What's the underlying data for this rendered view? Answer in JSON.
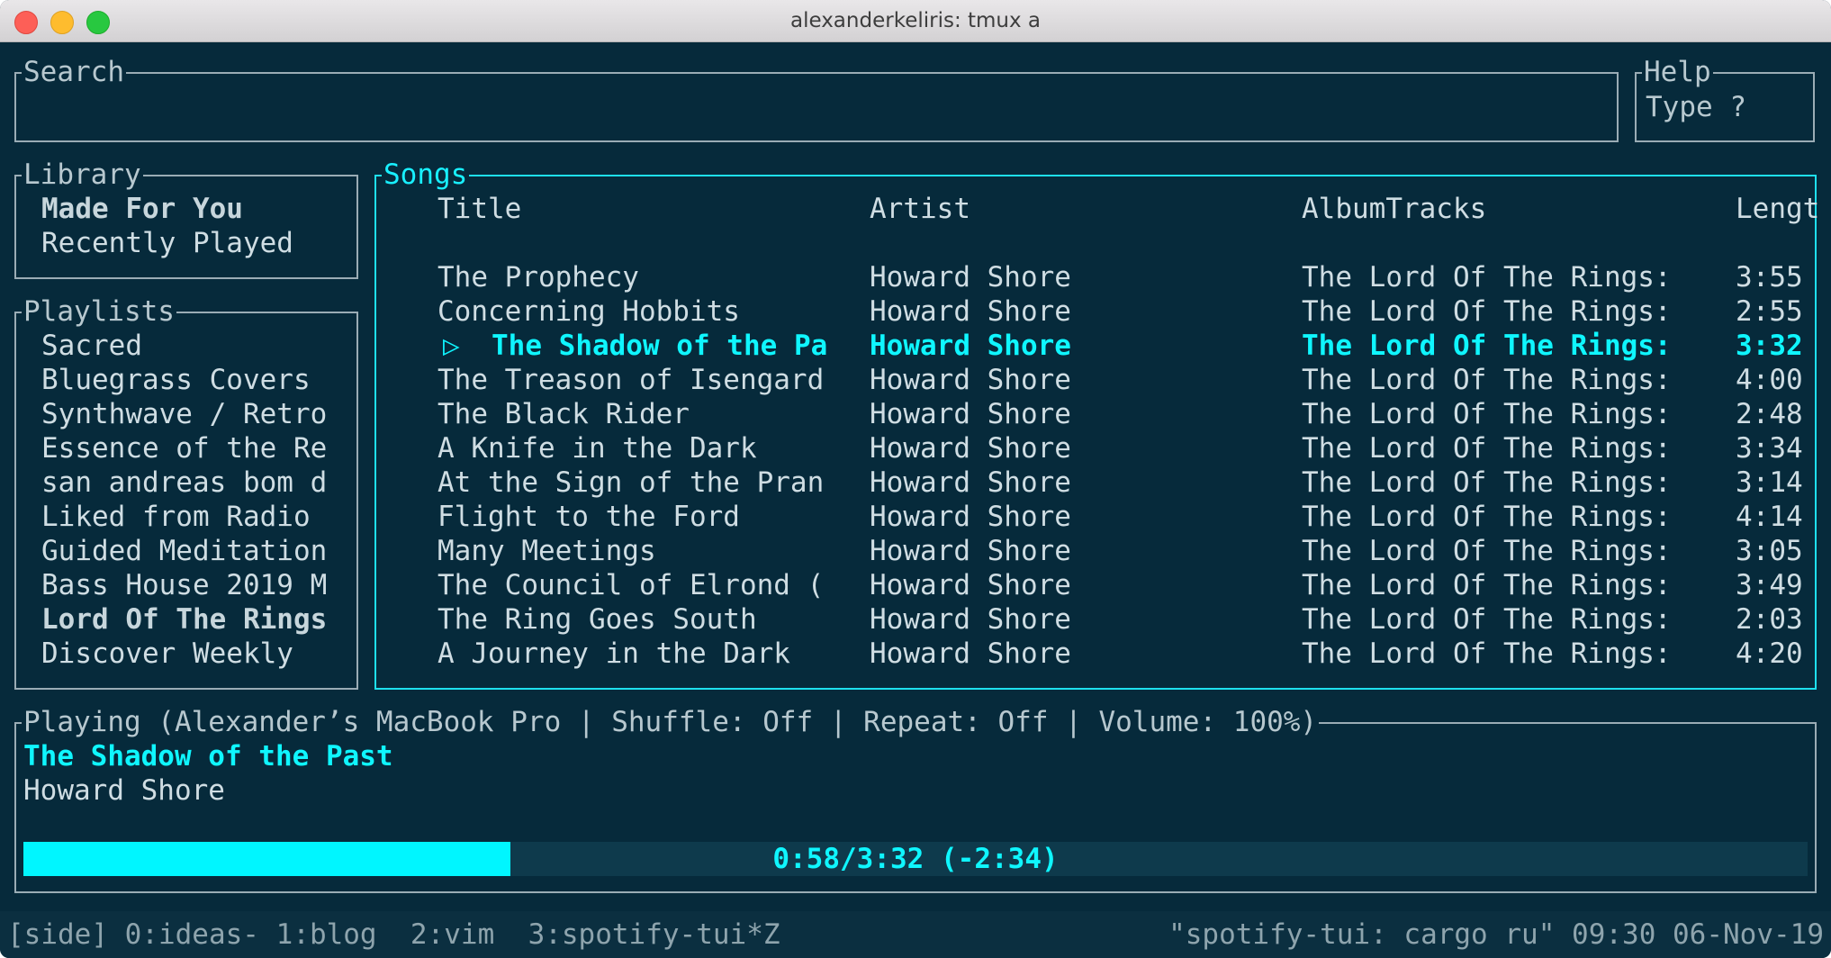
{
  "window": {
    "title": "alexanderkeliris: tmux a"
  },
  "search": {
    "label": "Search",
    "value": ""
  },
  "help": {
    "label": "Help",
    "hint": "Type ?"
  },
  "library": {
    "label": "Library",
    "items": [
      "Made For You",
      "Recently Played"
    ]
  },
  "playlists": {
    "label": "Playlists",
    "items": [
      "Sacred",
      "Bluegrass Covers",
      "Synthwave / Retro",
      "Essence of the Re",
      "san andreas bom d",
      "Liked from Radio",
      "Guided Meditation",
      "Bass House 2019 M",
      "Lord Of The Rings",
      "Discover Weekly"
    ]
  },
  "songs": {
    "label": "Songs",
    "columns": [
      "Title",
      "Artist",
      "AlbumTracks",
      "Lengt"
    ],
    "playing_marker": "▷",
    "rows": [
      {
        "title": "The Prophecy",
        "artist": "Howard Shore",
        "album": "The Lord Of The Rings:",
        "length": "3:55"
      },
      {
        "title": "Concerning Hobbits",
        "artist": "Howard Shore",
        "album": "The Lord Of The Rings:",
        "length": "2:55"
      },
      {
        "title": "The Shadow of the Pa",
        "artist": "Howard Shore",
        "album": "The Lord Of The Rings:",
        "length": "3:32"
      },
      {
        "title": "The Treason of Isengard",
        "artist": "Howard Shore",
        "album": "The Lord Of The Rings:",
        "length": "4:00"
      },
      {
        "title": "The Black Rider",
        "artist": "Howard Shore",
        "album": "The Lord Of The Rings:",
        "length": "2:48"
      },
      {
        "title": "A Knife in the Dark",
        "artist": "Howard Shore",
        "album": "The Lord Of The Rings:",
        "length": "3:34"
      },
      {
        "title": "At the Sign of the Pran",
        "artist": "Howard Shore",
        "album": "The Lord Of The Rings:",
        "length": "3:14"
      },
      {
        "title": "Flight to the Ford",
        "artist": "Howard Shore",
        "album": "The Lord Of The Rings:",
        "length": "4:14"
      },
      {
        "title": "Many Meetings",
        "artist": "Howard Shore",
        "album": "The Lord Of The Rings:",
        "length": "3:05"
      },
      {
        "title": "The Council of Elrond (",
        "artist": "Howard Shore",
        "album": "The Lord Of The Rings:",
        "length": "3:49"
      },
      {
        "title": "The Ring Goes South",
        "artist": "Howard Shore",
        "album": "The Lord Of The Rings:",
        "length": "2:03"
      },
      {
        "title": "A Journey in the Dark",
        "artist": "Howard Shore",
        "album": "The Lord Of The Rings:",
        "length": "4:20"
      }
    ]
  },
  "playing": {
    "label": "Playing (Alexander’s MacBook Pro | Shuffle: Off | Repeat: Off | Volume: 100%)",
    "track": "The Shadow of the Past",
    "artist": "Howard Shore",
    "progress_text": "0:58/3:32 (-2:34)",
    "progress_fraction": 0.273
  },
  "statusbar": {
    "left": "[side] 0:ideas- 1:blog  2:vim  3:spotify-tui*Z",
    "right": "\"spotify-tui: cargo ru\" 09:30 06-Nov-19"
  },
  "colors": {
    "accent": "#00f6ff",
    "background": "#062a3b",
    "border": "#9aacb5",
    "text": "#cfdde3"
  }
}
